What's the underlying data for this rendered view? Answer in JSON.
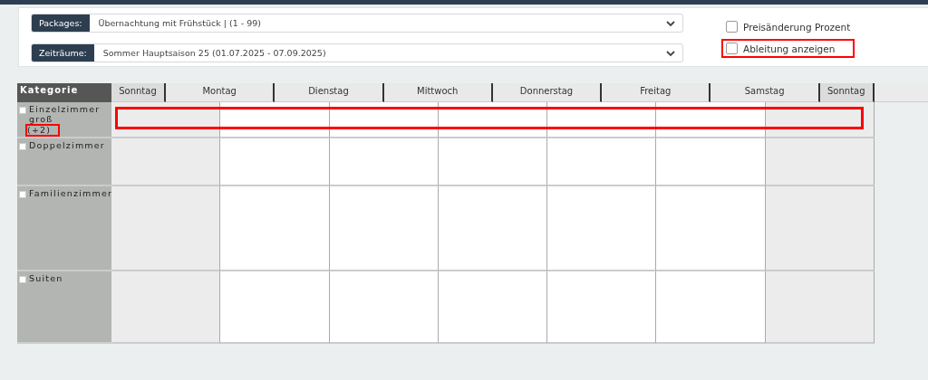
{
  "filters": [
    {
      "label": "Packages:",
      "value": "Übernachtung mit Frühstück | (1 - 99)"
    },
    {
      "label": "Zeiträume:",
      "value": "Sommer Hauptsaison 25 (01.07.2025 - 07.09.2025)"
    }
  ],
  "options": [
    {
      "label": "Preisänderung Prozent",
      "checked": false,
      "highlighted": false
    },
    {
      "label": "Ableitung anzeigen",
      "checked": false,
      "highlighted": true
    }
  ],
  "table": {
    "category_heading": "Kategorie",
    "days": [
      {
        "label": "Sonntag",
        "shaded": true
      },
      {
        "label": "Montag",
        "shaded": false
      },
      {
        "label": "Dienstag",
        "shaded": false
      },
      {
        "label": "Mittwoch",
        "shaded": false
      },
      {
        "label": "Donnerstag",
        "shaded": false
      },
      {
        "label": "Freitag",
        "shaded": false
      },
      {
        "label": "Samstag",
        "shaded": false
      },
      {
        "label": "Sonntag",
        "shaded": true
      }
    ],
    "body_columns": [
      {
        "shaded": true
      },
      {
        "shaded": false
      },
      {
        "shaded": false
      },
      {
        "shaded": false
      },
      {
        "shaded": false
      },
      {
        "shaded": false
      },
      {
        "shaded": true
      }
    ],
    "rows": [
      {
        "name": "Einzelzimmer groß",
        "extra": "(+2)",
        "extra_highlighted": true,
        "checked": false,
        "highlighted": true
      },
      {
        "name": "Doppelzimmer",
        "checked": false,
        "highlighted": false
      },
      {
        "name": "Familienzimmer",
        "checked": false,
        "highlighted": false
      },
      {
        "name": "Suiten",
        "checked": false,
        "highlighted": false
      }
    ]
  }
}
